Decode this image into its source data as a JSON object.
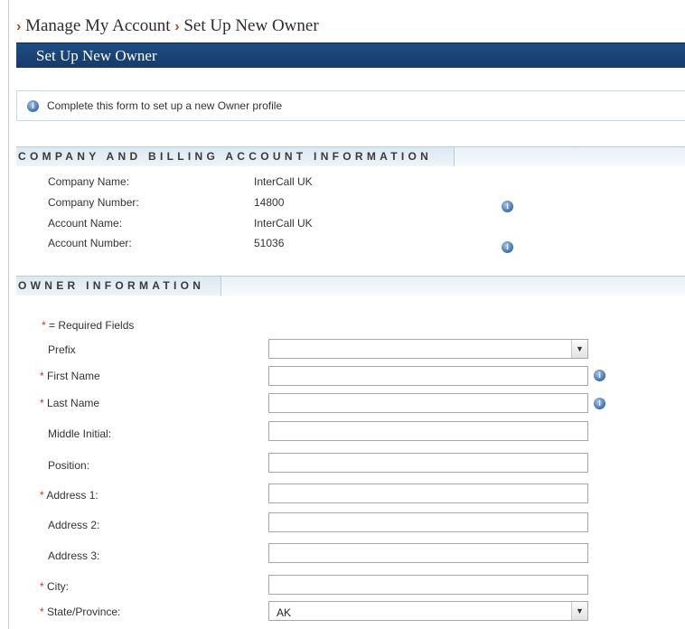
{
  "breadcrumb": {
    "items": [
      "Manage My Account",
      "Set Up New Owner"
    ]
  },
  "header": {
    "title": "Set Up New Owner"
  },
  "notice": {
    "text": "Complete this form to set up a new Owner profile"
  },
  "company_section": {
    "title": "COMPANY AND BILLING ACCOUNT INFORMATION",
    "rows": [
      {
        "label": "Company Name:",
        "value": "InterCall UK"
      },
      {
        "label": "Company Number:",
        "value": "14800"
      },
      {
        "label": "Account Name:",
        "value": "InterCall UK"
      },
      {
        "label": "Account Number:",
        "value": "51036"
      }
    ]
  },
  "owner_section": {
    "title": "OWNER INFORMATION",
    "required_note": "= Required Fields",
    "required_marker": "*",
    "fields": {
      "prefix": {
        "label": "Prefix",
        "value": ""
      },
      "first_name": {
        "label": "First Name",
        "value": ""
      },
      "last_name": {
        "label": "Last Name",
        "value": ""
      },
      "middle_initial": {
        "label": "Middle Initial:",
        "value": ""
      },
      "position": {
        "label": "Position:",
        "value": ""
      },
      "address1": {
        "label": "Address 1:",
        "value": ""
      },
      "address2": {
        "label": "Address 2:",
        "value": ""
      },
      "address3": {
        "label": "Address 3:",
        "value": ""
      },
      "city": {
        "label": "City:",
        "value": ""
      },
      "state": {
        "label": "State/Province:",
        "value": "AK"
      }
    }
  },
  "icons": {
    "info": "info-icon",
    "breadcrumb_separator": "chevron-right-icon",
    "dropdown": "chevron-down-icon"
  },
  "colors": {
    "header_bg": "#1e4c84",
    "accent_chevron": "#b5482a",
    "required_star": "#c0392b"
  }
}
